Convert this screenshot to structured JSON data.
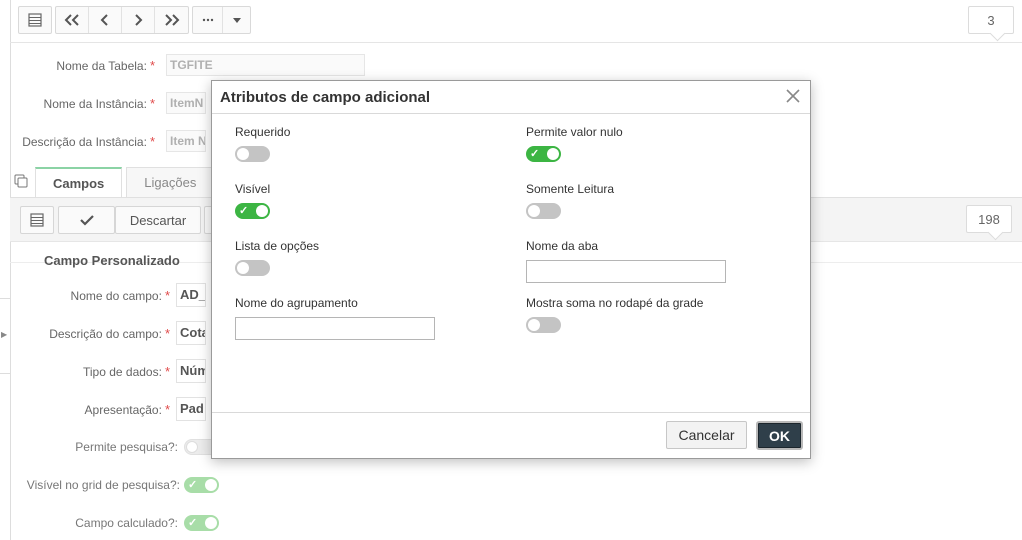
{
  "toolbar": {
    "icons": [
      "grid-icon",
      "first-page-icon",
      "prev-icon",
      "next-icon",
      "last-page-icon",
      "more-icon",
      "dropdown-icon"
    ],
    "record_counter": "3"
  },
  "form": {
    "table_name": {
      "label": "Nome da Tabela:",
      "value": "TGFITE"
    },
    "instance_name": {
      "label": "Nome da Instância:",
      "value": "ItemN"
    },
    "instance_desc": {
      "label": "Descrição da Instância:",
      "value": "Item N"
    }
  },
  "tabs": [
    {
      "label": "Campos",
      "active": true
    },
    {
      "label": "Ligações",
      "active": false
    }
  ],
  "fields_toolbar": {
    "discard_label": "Descartar",
    "counter": "198"
  },
  "section": {
    "title": "Campo Personalizado",
    "fields": [
      {
        "label": "Nome do campo:",
        "value": "AD_"
      },
      {
        "label": "Descrição do campo:",
        "value": "Cota"
      },
      {
        "label": "Tipo de dados:",
        "value": "Núm"
      },
      {
        "label": "Apresentação:",
        "value": "Pad"
      }
    ],
    "toggles": [
      {
        "label": "Permite pesquisa?:",
        "on": false
      },
      {
        "label": "Visível no grid de pesquisa?:",
        "on": true
      },
      {
        "label": "Campo calculado?:",
        "on": true
      }
    ]
  },
  "modal": {
    "title": "Atributos de campo adicional",
    "fields": {
      "requerido": {
        "label": "Requerido",
        "on": false
      },
      "permite_nulo": {
        "label": "Permite valor nulo",
        "on": true
      },
      "visivel": {
        "label": "Visível",
        "on": true
      },
      "somente_leitura": {
        "label": "Somente Leitura",
        "on": false
      },
      "lista_opcoes": {
        "label": "Lista de opções",
        "on": false
      },
      "nome_aba": {
        "label": "Nome da aba",
        "value": ""
      },
      "nome_agrupamento": {
        "label": "Nome do agrupamento",
        "value": ""
      },
      "mostra_soma": {
        "label": "Mostra soma no rodapé da grade",
        "on": false
      }
    },
    "cancel_label": "Cancelar",
    "ok_label": "OK"
  },
  "colors": {
    "toggle_on": "#3cb543",
    "toggle_off": "#c4c4c4",
    "ok_button": "#2f3f4a",
    "required_star": "#e04a4a",
    "active_tab_accent": "#8bd3a5"
  }
}
